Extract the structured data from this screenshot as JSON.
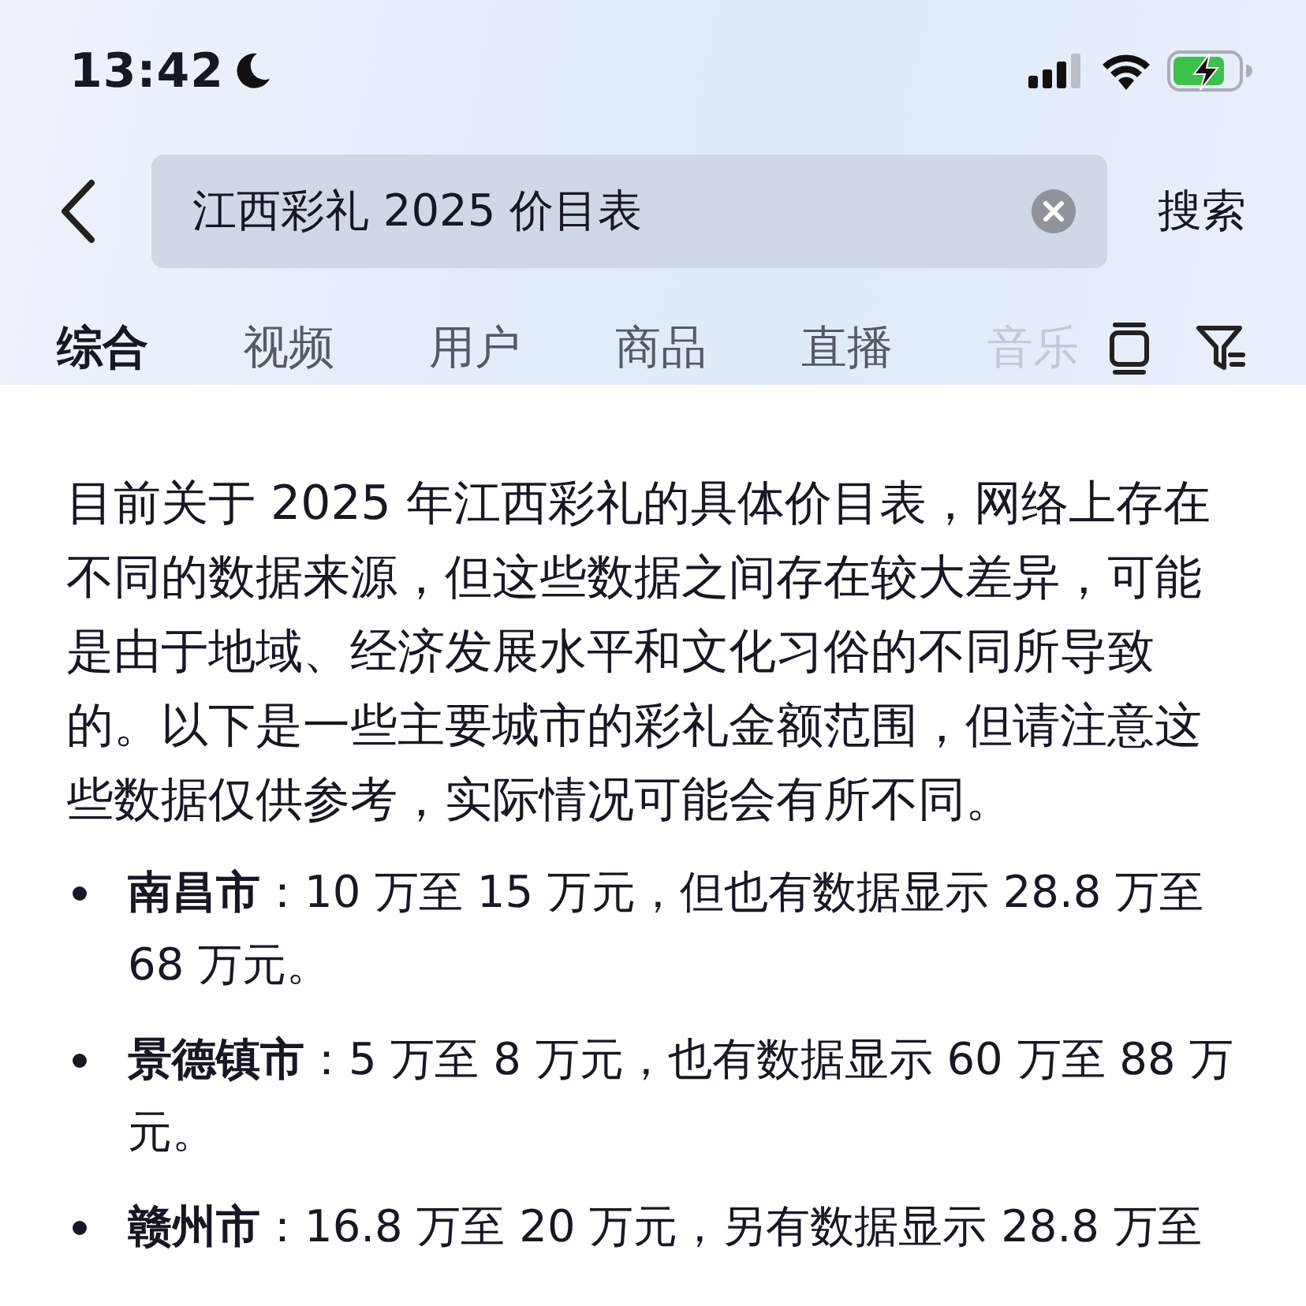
{
  "status_bar": {
    "time": "13:42"
  },
  "search": {
    "value": "江西彩礼 2025 价目表",
    "button": "搜索"
  },
  "tabs": [
    {
      "label": "综合",
      "selected": true
    },
    {
      "label": "视频",
      "selected": false
    },
    {
      "label": "用户",
      "selected": false
    },
    {
      "label": "商品",
      "selected": false
    },
    {
      "label": "直播",
      "selected": false
    },
    {
      "label": "音乐",
      "selected": false
    }
  ],
  "answer": {
    "intro": "目前关于 2025 年江西彩礼的具体价目表，网络上存在不同的数据来源，但这些数据之间存在较大差异，可能是由于地域、经济发展水平和文化习俗的不同所导致的。以下是一些主要城市的彩礼金额范围，但请注意这些数据仅供参考，实际情况可能会有所不同。",
    "items": [
      {
        "text": "**南昌市**：10 万至 15 万元，但也有数据显示 28.8 万至 68 万元。"
      },
      {
        "text": "**景德镇市**：5 万至 8 万元，也有数据显示 60 万至 88 万元。"
      },
      {
        "text": "**赣州市**：16.8 万至 20 万元，另有数据显示 28.8 万至"
      }
    ]
  }
}
